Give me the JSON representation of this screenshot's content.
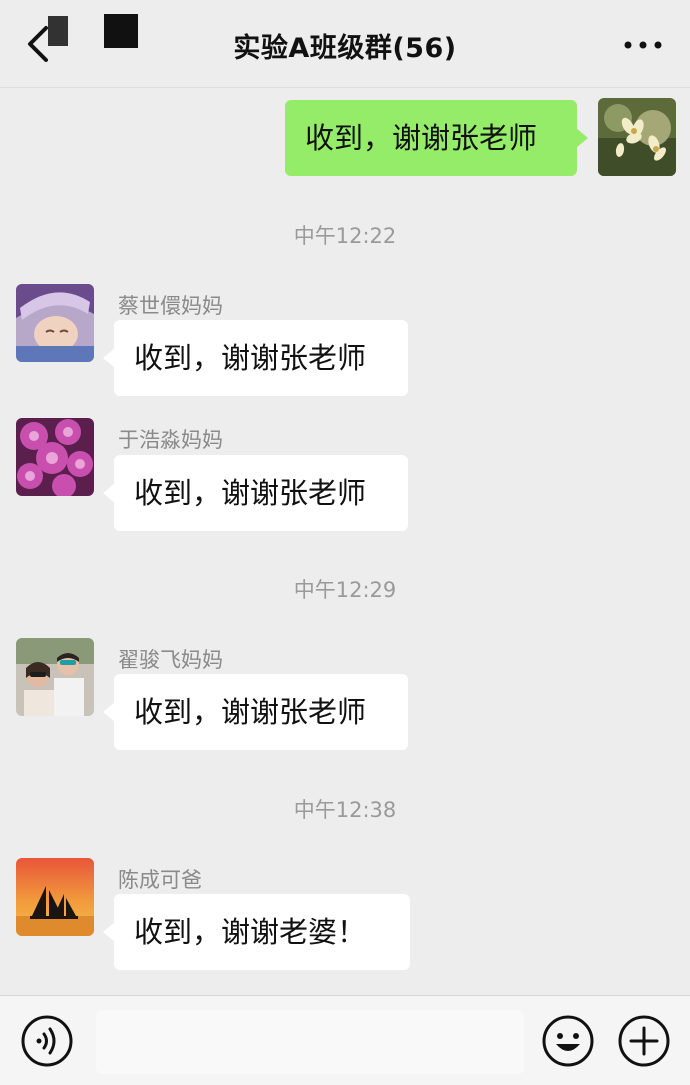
{
  "header": {
    "title": "实验A班级群(56)",
    "back_icon": "chevron-left-icon",
    "more_icon": "more-dots-icon"
  },
  "messages": [
    {
      "type": "outgoing",
      "text": "收到，谢谢张老师",
      "avatar": "flower-avatar"
    },
    {
      "type": "time",
      "text": "中午12:22"
    },
    {
      "type": "incoming",
      "sender": "蔡世儇妈妈",
      "text": "收到，谢谢张老师",
      "avatar": "baby-avatar"
    },
    {
      "type": "incoming",
      "sender": "于浩淼妈妈",
      "text": "收到，谢谢张老师",
      "avatar": "purple-flowers-avatar"
    },
    {
      "type": "time",
      "text": "中午12:29"
    },
    {
      "type": "incoming",
      "sender": "翟骏飞妈妈",
      "text": "收到，谢谢张老师",
      "avatar": "couple-photo-avatar"
    },
    {
      "type": "time",
      "text": "中午12:38"
    },
    {
      "type": "incoming",
      "sender": "陈成可爸",
      "text": "收到，谢谢老婆！",
      "avatar": "sunset-sailboat-avatar"
    }
  ],
  "input_bar": {
    "voice_icon": "voice-icon",
    "emoji_icon": "emoji-icon",
    "add_icon": "plus-icon"
  },
  "colors": {
    "background": "#ededed",
    "outgoing_bubble": "#95ec69",
    "incoming_bubble": "#ffffff"
  }
}
